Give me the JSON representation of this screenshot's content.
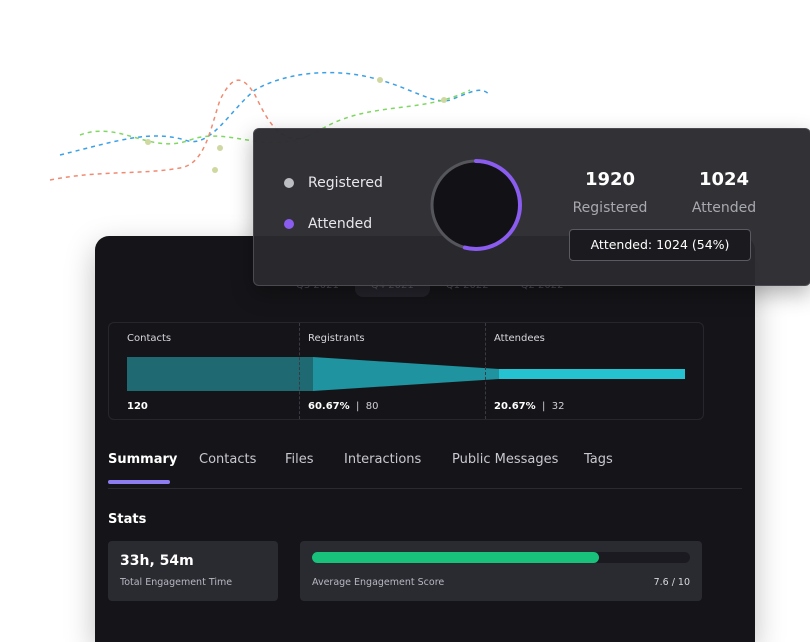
{
  "quarters": [
    "Q3 2021",
    "Q4 2021",
    "Q1 2022",
    "Q2 2022"
  ],
  "funnel": {
    "stages": [
      {
        "label": "Contacts",
        "percent": "",
        "count": "120"
      },
      {
        "label": "Registrants",
        "percent": "60.67%",
        "count": "80"
      },
      {
        "label": "Attendees",
        "percent": "20.67%",
        "count": "32"
      }
    ],
    "separator": "|"
  },
  "tabs": [
    "Summary",
    "Contacts",
    "Files",
    "Interactions",
    "Public Messages",
    "Tags"
  ],
  "stats": {
    "title": "Stats",
    "engagement_time": "33h, 54m",
    "engagement_time_label": "Total Engagement Time",
    "score_label": "Average Engagement Score",
    "score_value": "7.6 / 10",
    "score_fraction": 0.76
  },
  "popup": {
    "legend": [
      {
        "label": "Registered",
        "color": "#bdbdc4"
      },
      {
        "label": "Attended",
        "color": "#8a5cf0"
      }
    ],
    "registered_value": "1920",
    "registered_label": "Registered",
    "attended_value": "1024",
    "attended_label": "Attended",
    "tooltip": "Attended: 1024 (54%)",
    "attended_fraction": 0.54
  },
  "colors": {
    "accent": "#8d7df0",
    "funnel": "#25c3d1",
    "progress": "#19c27a"
  }
}
